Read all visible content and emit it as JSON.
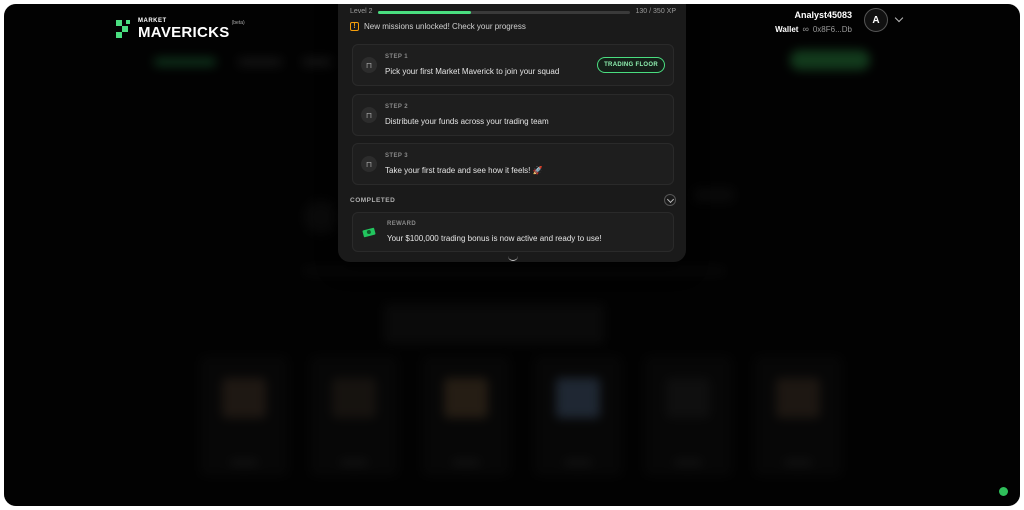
{
  "brand": {
    "small": "MARKET",
    "big": "MAVERICKS",
    "tag": "(beta)"
  },
  "user": {
    "name": "Analyst45083",
    "wallet_label": "Wallet",
    "wallet_address": "0x8F6...Db",
    "avatar_letter": "A"
  },
  "progress": {
    "level_label": "Level 2",
    "xp_text": "130 / 350 XP",
    "fraction": 0.37
  },
  "notice": "New missions unlocked! Check your progress",
  "steps": [
    {
      "tag": "STEP 1",
      "text": "Pick your first Market Maverick to join your squad",
      "button": "TRADING FLOOR"
    },
    {
      "tag": "STEP 2",
      "text": "Distribute your funds across your trading team"
    },
    {
      "tag": "STEP 3",
      "text": "Take your first trade and see how it feels! 🚀"
    }
  ],
  "completed": {
    "heading": "COMPLETED",
    "tag": "REWARD",
    "text": "Your $100,000 trading bonus is now active and ready to use!"
  },
  "colors": {
    "accent": "#4ade80",
    "warning": "#f59e0b",
    "background": "#050505",
    "panel": "#1a1a1a"
  },
  "icons": [
    "logo-icon",
    "link-icon",
    "chevron-down-icon",
    "warning-icon",
    "chair-icon",
    "cash-icon",
    "chevron-up-icon"
  ]
}
